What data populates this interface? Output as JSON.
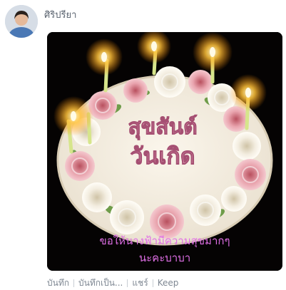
{
  "message": {
    "sender_name": "ศิริปรียา",
    "image": {
      "greeting_line1": "สุขสันต์",
      "greeting_line2": "วันเกิด",
      "caption_line1": "ขอให้นางฟ้ามีความสุขมากๆ",
      "caption_line2": "นะคะบาบา"
    },
    "actions": [
      {
        "label": "บันทึก"
      },
      {
        "label": "บันทึกเป็น..."
      },
      {
        "label": "แชร์"
      },
      {
        "label": "Keep"
      }
    ]
  }
}
